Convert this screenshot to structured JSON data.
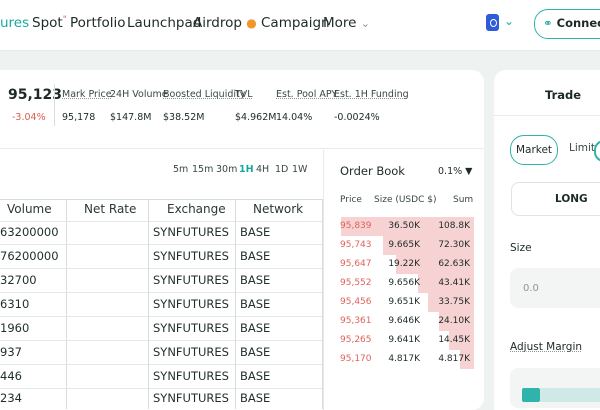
{
  "nav": {
    "items": [
      "ures",
      "Spot",
      "Portfolio",
      "Launchpad",
      "Airdrop",
      "Campaign",
      "More"
    ],
    "spot_badge": "\"",
    "connect_label": "Connect W"
  },
  "stats": {
    "price": "95,123",
    "change": "-3.04%",
    "mark_price_label": "Mark Price",
    "mark_price_value": "95,178",
    "volume_label": "24H Volume",
    "volume_value": "$147.8M",
    "liquidity_label": "Boosted Liquidity",
    "liquidity_value": "$38.52M",
    "tvl_label": "TVL",
    "tvl_value": "$4.962M",
    "apy_label": "Est. Pool APY",
    "apy_value": "14.04%",
    "funding_label": "Est. 1H Funding",
    "funding_value": "-0.0024%"
  },
  "timeframes": [
    "5m",
    "15m",
    "30m",
    "1H",
    "4H",
    "1D",
    "1W"
  ],
  "timeframe_active": "1H",
  "table": {
    "headers": [
      "Volume",
      "Net Rate",
      "Exchange",
      "Network"
    ],
    "rows": [
      [
        "63200000",
        "",
        "SYNFUTURES",
        "BASE"
      ],
      [
        "76200000",
        "",
        "SYNFUTURES",
        "BASE"
      ],
      [
        "32700",
        "",
        "SYNFUTURES",
        "BASE"
      ],
      [
        "6310",
        "",
        "SYNFUTURES",
        "BASE"
      ],
      [
        "1960",
        "",
        "SYNFUTURES",
        "BASE"
      ],
      [
        "937",
        "",
        "SYNFUTURES",
        "BASE"
      ],
      [
        "446",
        "",
        "SYNFUTURES",
        "BASE"
      ],
      [
        "234",
        "",
        "SYNFUTURES",
        "BASE"
      ]
    ]
  },
  "order_book": {
    "title": "Order Book",
    "precision": "0.1%",
    "headers": [
      "Price",
      "Size (USDC $)",
      "Sum"
    ],
    "rows": [
      {
        "price": "95,839",
        "size": "36.50K",
        "sum": "108.8K",
        "depth": 0.95
      },
      {
        "price": "95,743",
        "size": "9.665K",
        "sum": "72.30K",
        "depth": 0.65
      },
      {
        "price": "95,647",
        "size": "19.22K",
        "sum": "62.63K",
        "depth": 0.56
      },
      {
        "price": "95,552",
        "size": "9.656K",
        "sum": "43.41K",
        "depth": 0.4
      },
      {
        "price": "95,456",
        "size": "9.651K",
        "sum": "33.75K",
        "depth": 0.33
      },
      {
        "price": "95,361",
        "size": "9.646K",
        "sum": "24.10K",
        "depth": 0.25
      },
      {
        "price": "95,265",
        "size": "9.641K",
        "sum": "14.45K",
        "depth": 0.18
      },
      {
        "price": "95,170",
        "size": "4.817K",
        "sum": "4.817K",
        "depth": 0.1
      }
    ]
  },
  "trade": {
    "title": "Trade",
    "market_label": "Market",
    "limit_label": "Limit",
    "long_label": "LONG",
    "size_label": "Size",
    "size_value": "0.0",
    "adjust_label": "Adjust Margin"
  }
}
